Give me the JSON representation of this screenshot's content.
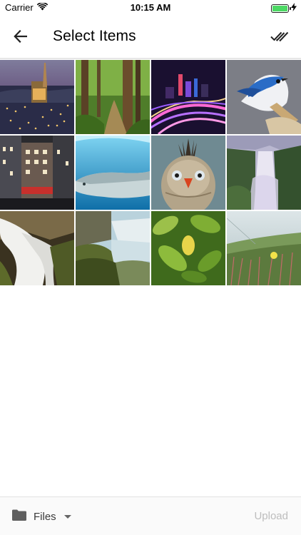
{
  "status_bar": {
    "carrier": "Carrier",
    "time": "10:15 AM",
    "battery_level": 1.0,
    "battery_color": "#4cd964"
  },
  "nav": {
    "back_icon": "arrow-left-icon",
    "title": "Select Items",
    "select_all_icon": "double-check-icon"
  },
  "grid": {
    "items": [
      {
        "subject": "city-cathedral-night"
      },
      {
        "subject": "forest-path"
      },
      {
        "subject": "city-light-trails"
      },
      {
        "subject": "blue-jay"
      },
      {
        "subject": "buildings-night"
      },
      {
        "subject": "whale-underwater"
      },
      {
        "subject": "crested-bird"
      },
      {
        "subject": "waterfall-mist"
      },
      {
        "subject": "waterfall-rocks"
      },
      {
        "subject": "waterfall-river"
      },
      {
        "subject": "green-leaves"
      },
      {
        "subject": "coastal-flowers"
      }
    ]
  },
  "toolbar": {
    "folder_icon": "folder-icon",
    "files_label": "Files",
    "upload_label": "Upload",
    "upload_color": "#bdbdbd"
  }
}
